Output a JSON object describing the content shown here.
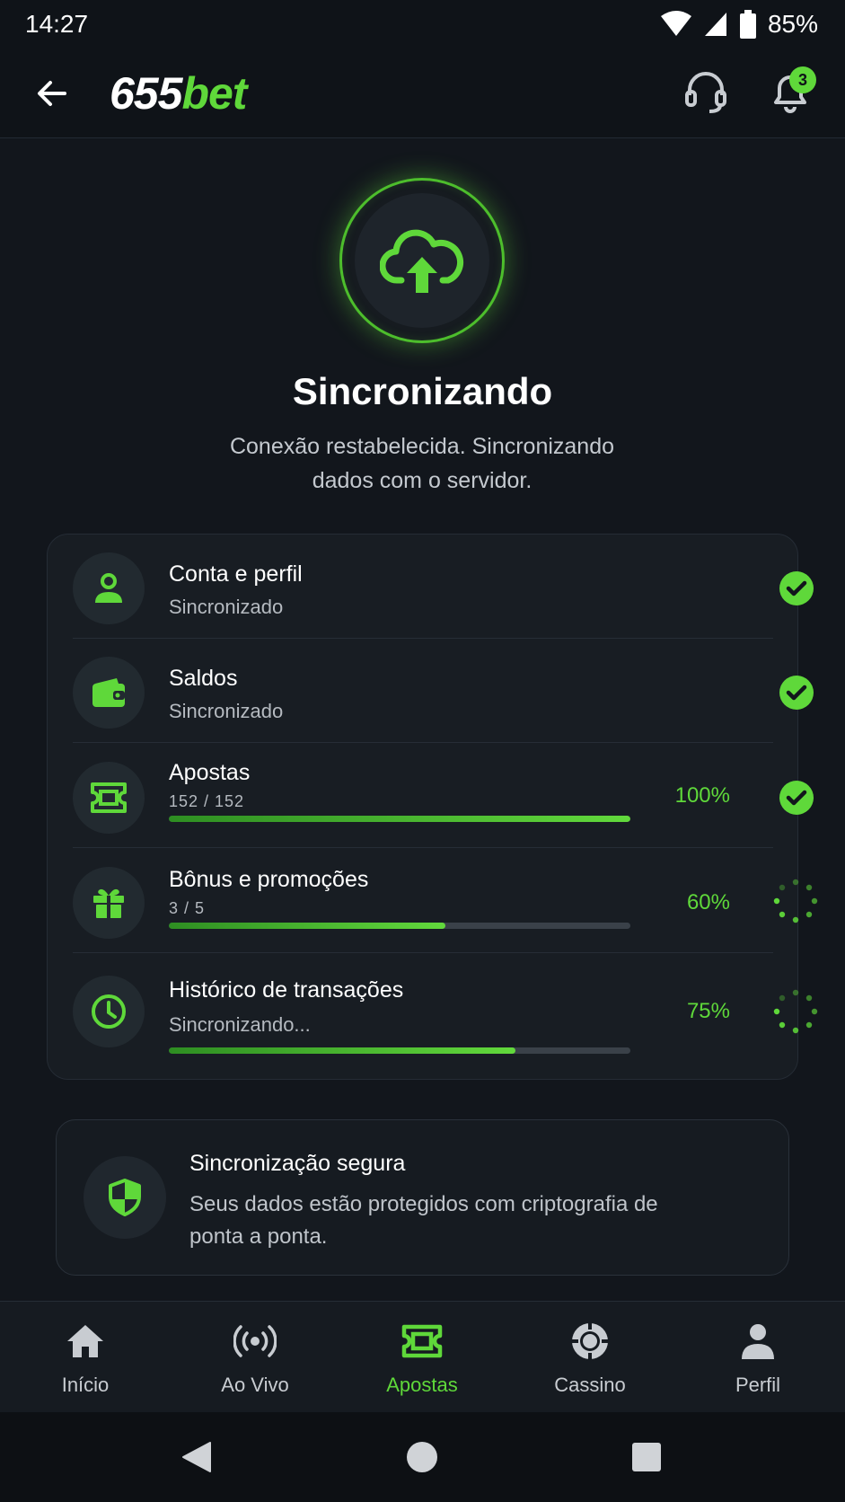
{
  "status_bar": {
    "time": "14:27",
    "battery": "85%"
  },
  "header": {
    "logo_number": "655",
    "logo_bet": "bet",
    "notification_count": "3"
  },
  "hero": {
    "title": "Sincronizando",
    "subtitle": "Conexão restabelecida. Sincronizando dados com o servidor."
  },
  "sync_items": [
    {
      "title": "Conta e perfil",
      "subtitle": "Sincronizado",
      "icon": "user-icon",
      "state": "done"
    },
    {
      "title": "Saldos",
      "subtitle": "Sincronizado",
      "icon": "wallet-icon",
      "state": "done"
    },
    {
      "title": "Apostas",
      "count": "152 / 152",
      "progress": 1.0,
      "percent": "100%",
      "icon": "ticket-icon",
      "state": "done"
    },
    {
      "title": "Bônus e promoções",
      "count": "3 / 5",
      "progress": 0.6,
      "percent": "60%",
      "icon": "gift-icon",
      "state": "loading"
    },
    {
      "title": "Histórico de transações",
      "subtitle": "Sincronizando...",
      "progress": 0.75,
      "percent": "75%",
      "icon": "clock-icon",
      "state": "loading"
    }
  ],
  "secure": {
    "title": "Sincronização segura",
    "text": "Seus dados estão protegidos com criptografia de ponta a ponta."
  },
  "bottom_nav": [
    {
      "label": "Início",
      "icon": "home-icon"
    },
    {
      "label": "Ao Vivo",
      "icon": "live-icon"
    },
    {
      "label": "Apostas",
      "icon": "ticket-icon",
      "active": true
    },
    {
      "label": "Cassino",
      "icon": "casino-chip-icon"
    },
    {
      "label": "Perfil",
      "icon": "person-icon"
    }
  ],
  "colors": {
    "accent": "#5fd83a",
    "background": "#12161c",
    "card": "#181d23"
  }
}
